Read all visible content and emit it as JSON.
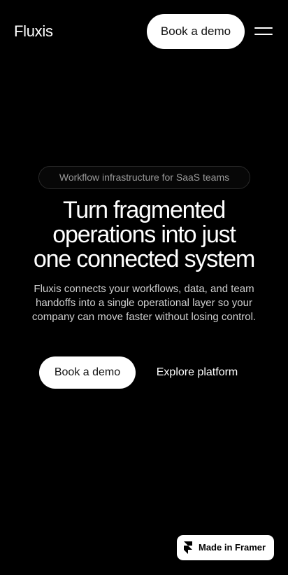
{
  "nav": {
    "logo": "Fluxis",
    "cta_label": "Book a demo",
    "menu_icon": "hamburger-menu-icon"
  },
  "hero": {
    "badge": "Workflow infrastructure for SaaS teams",
    "title_lines": [
      "Turn fragmented",
      "operations into just",
      "one connected system"
    ],
    "subtitle": "Fluxis connects your workflows, data, and team handoffs into a single operational layer so your company can move faster without losing control.",
    "primary_cta": "Book a demo",
    "secondary_cta": "Explore platform"
  },
  "framer_badge": {
    "label": "Made in Framer",
    "icon": "framer-logo-icon"
  },
  "colors": {
    "background": "#000000",
    "text": "#ffffff",
    "muted_text": "#9a9a9a",
    "button_bg": "#ffffff",
    "button_text": "#111111"
  }
}
